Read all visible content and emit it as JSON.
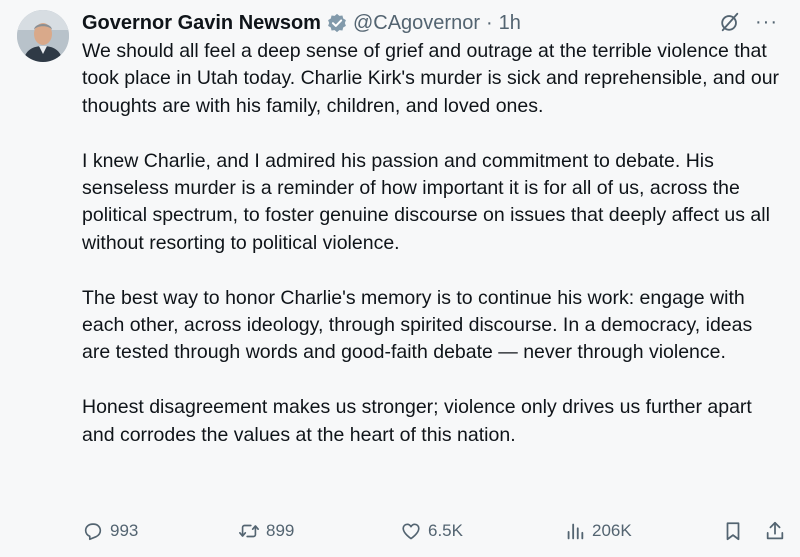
{
  "author": {
    "name": "Governor Gavin Newsom",
    "handle": "@CAgovernor",
    "separator": "·",
    "time": "1h"
  },
  "icons": {
    "verified": "government-verified-badge-icon",
    "grok": "grok-icon",
    "more": "more-options-icon"
  },
  "colors": {
    "background": "#f7f8f9",
    "text": "#0f1419",
    "secondary": "#536471",
    "verified_badge": "#829aab"
  },
  "more_label": "···",
  "paragraphs": [
    "We should all feel a deep sense of grief and outrage at the terrible violence that took place in Utah today. Charlie Kirk's murder is sick and reprehensible, and our thoughts are with his family, children, and loved ones.",
    "I knew Charlie, and I admired his passion and commitment to debate. His senseless murder is a reminder of how important it is for all of us, across the political spectrum, to foster genuine discourse on issues that deeply affect us all without resorting to political violence.",
    "The best way to honor Charlie's memory is to continue his work: engage with each other, across ideology, through spirited discourse. In a democracy, ideas are tested through words and good-faith debate — never through violence.",
    "Honest disagreement makes us stronger; violence only drives us further apart and corrodes the values at the heart of this nation."
  ],
  "actions": {
    "replies": "993",
    "reposts": "899",
    "likes": "6.5K",
    "views": "206K"
  }
}
